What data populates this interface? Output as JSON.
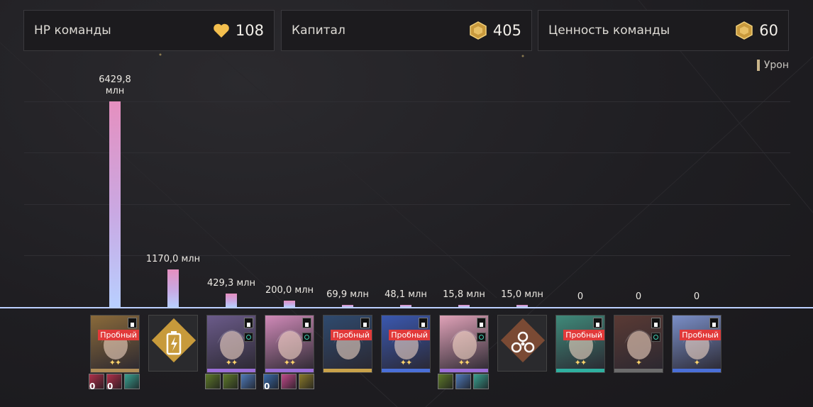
{
  "stats": {
    "team_hp": {
      "label": "HP команды",
      "value": "108",
      "icon": "heart-icon"
    },
    "capital": {
      "label": "Капитал",
      "value": "405",
      "icon": "coin-icon"
    },
    "team_value": {
      "label": "Ценность команды",
      "value": "60",
      "icon": "coin-icon"
    }
  },
  "legend": {
    "label": "Урон",
    "color": "#c9b48a"
  },
  "chart_data": {
    "type": "bar",
    "ylabel": "",
    "series": [
      {
        "name": "Урон",
        "values": [
          6429.8,
          1170.0,
          429.3,
          200.0,
          69.9,
          48.1,
          15.8,
          15.0,
          0,
          0,
          0
        ]
      }
    ],
    "data_labels": [
      "6429,8\nмлн",
      "1170,0 млн",
      "429,3 млн",
      "200,0 млн",
      "69,9 млн",
      "48,1 млн",
      "15,8 млн",
      "15,0 млн",
      "0",
      "0",
      "0"
    ],
    "colors": {
      "bar_top": "#e58fbf",
      "bar_bottom": "#b8cfff"
    }
  },
  "units": [
    {
      "kind": "character",
      "trial": true,
      "trial_label": "Пробный",
      "stars": "✦✦",
      "accent": "#b08d57",
      "art": "#8a6a3a",
      "ring": false
    },
    {
      "kind": "special",
      "icon": "battery-icon",
      "color": "#c79a3b"
    },
    {
      "kind": "character",
      "trial": false,
      "trial_label": "",
      "stars": "✦✦",
      "accent": "#9b6fd8",
      "art": "#6b5b8a",
      "ring": true
    },
    {
      "kind": "character",
      "trial": false,
      "trial_label": "",
      "stars": "✦✦",
      "accent": "#9b6fd8",
      "art": "#d08ab8",
      "ring": true
    },
    {
      "kind": "character",
      "trial": true,
      "trial_label": "Пробный",
      "stars": "",
      "accent": "#c9a24a",
      "art": "#2f4a6e",
      "ring": false
    },
    {
      "kind": "character",
      "trial": true,
      "trial_label": "Пробный",
      "stars": "✦✦",
      "accent": "#4a6fd8",
      "art": "#3a58b0",
      "ring": false
    },
    {
      "kind": "character",
      "trial": false,
      "trial_label": "",
      "stars": "✦✦",
      "accent": "#9b6fd8",
      "art": "#e0a2b8",
      "ring": true
    },
    {
      "kind": "special",
      "icon": "summon-icon",
      "color": "#7a4a34"
    },
    {
      "kind": "character",
      "trial": true,
      "trial_label": "Пробный",
      "stars": "✦✦",
      "accent": "#2fb0a0",
      "art": "#3f8a7a",
      "ring": false
    },
    {
      "kind": "character",
      "trial": false,
      "trial_label": "",
      "stars": "✦",
      "accent": "#6c6c6c",
      "art": "#5a3a34",
      "ring": true
    },
    {
      "kind": "character",
      "trial": true,
      "trial_label": "Пробный",
      "stars": "✦",
      "accent": "#4a6fd8",
      "art": "#7a8fc8",
      "ring": false
    }
  ],
  "relics": [
    {
      "unit": 0,
      "items": [
        {
          "color": "#b0304a",
          "count": "0"
        },
        {
          "color": "#b0304a",
          "count": "0"
        },
        {
          "color": "#3aa090",
          "count": ""
        }
      ]
    },
    {
      "unit": 2,
      "items": [
        {
          "color": "#5e7a2a",
          "count": ""
        },
        {
          "color": "#5e7a2a",
          "count": ""
        },
        {
          "color": "#4f7ab8",
          "count": ""
        }
      ]
    },
    {
      "unit": 3,
      "items": [
        {
          "color": "#3a6aa8",
          "count": "0"
        },
        {
          "color": "#c04a8a",
          "count": ""
        },
        {
          "color": "#8a7a2a",
          "count": ""
        }
      ]
    },
    {
      "unit": 6,
      "items": [
        {
          "color": "#5e7a2a",
          "count": ""
        },
        {
          "color": "#4f7ab8",
          "count": ""
        },
        {
          "color": "#3aa090",
          "count": ""
        }
      ]
    }
  ]
}
